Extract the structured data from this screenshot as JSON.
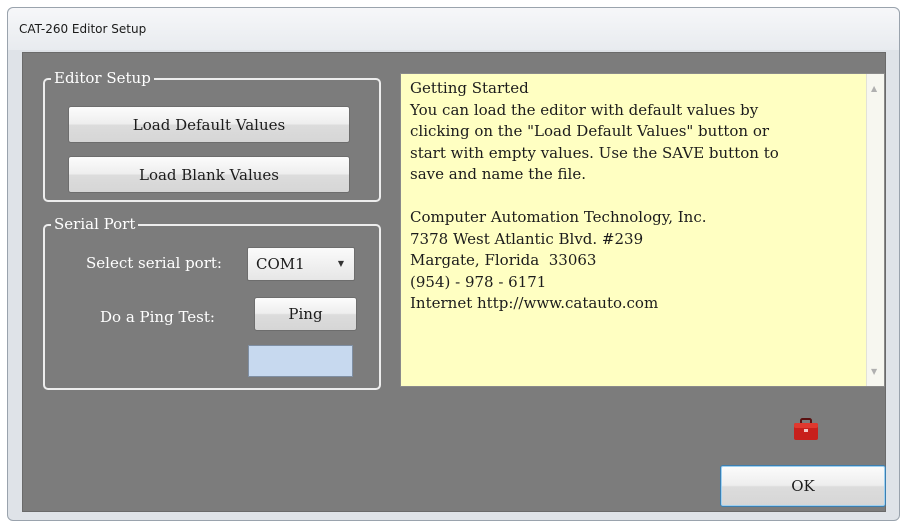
{
  "window": {
    "title": "CAT-260 Editor Setup"
  },
  "editor_setup": {
    "legend": "Editor Setup",
    "load_default_label": "Load Default Values",
    "load_blank_label": "Load Blank Values"
  },
  "serial_port": {
    "legend": "Serial Port",
    "select_label": "Select serial port:",
    "selected_port": "COM1",
    "ping_label": "Do a Ping Test:",
    "ping_button": "Ping",
    "ping_result": ""
  },
  "info": {
    "lines": [
      "Getting Started",
      "You can load the editor with default values by",
      "clicking on the \"Load Default Values\" button or",
      "start with empty values. Use the SAVE button to",
      "save and name the file.",
      "",
      "Computer Automation Technology, Inc.",
      "7378 West Atlantic Blvd. #239",
      "Margate, Florida  33063",
      "(954) - 978 - 6171",
      "Internet http://www.catauto.com"
    ]
  },
  "icons": {
    "toolbox": "toolbox-icon",
    "dropdown": "chevron-down-icon"
  },
  "footer": {
    "ok_label": "OK"
  },
  "colors": {
    "client_bg": "#7c7c7c",
    "info_bg": "#ffffc2",
    "toolbox_red": "#c8201c",
    "result_box": "#c7d9ef"
  }
}
